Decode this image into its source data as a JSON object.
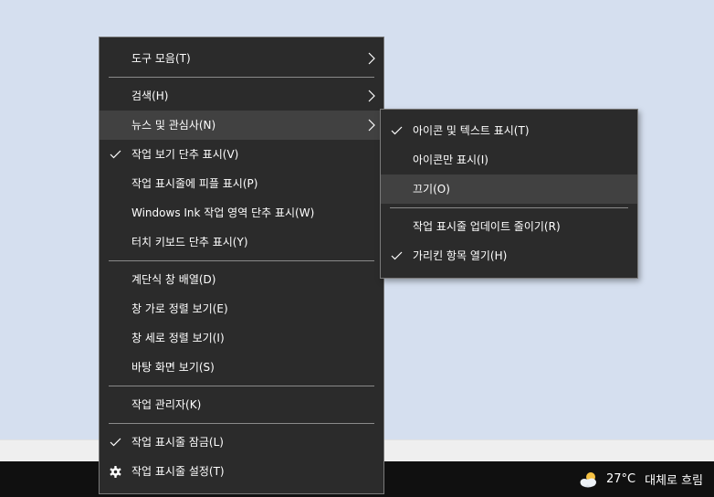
{
  "main_menu": {
    "toolbars": "도구 모음(T)",
    "search": "검색(H)",
    "news": "뉴스 및 관심사(N)",
    "show_task_view": "작업 보기 단추 표시(V)",
    "show_people": "작업 표시줄에 피플 표시(P)",
    "show_ink": "Windows Ink 작업 영역 단추 표시(W)",
    "show_touch_keyboard": "터치 키보드 단추 표시(Y)",
    "cascade": "계단식 창 배열(D)",
    "stacked": "창 가로 정렬 보기(E)",
    "side_by_side": "창 세로 정렬 보기(I)",
    "show_desktop": "바탕 화면 보기(S)",
    "task_manager": "작업 관리자(K)",
    "lock_taskbar": "작업 표시줄 잠금(L)",
    "taskbar_settings": "작업 표시줄 설정(T)"
  },
  "sub_menu": {
    "icon_and_text": "아이콘 및 텍스트 표시(T)",
    "icon_only": "아이콘만 표시(I)",
    "turn_off": "끄기(O)",
    "reduce_updates": "작업 표시줄 업데이트 줄이기(R)",
    "open_on_hover": "가리킨 항목 열기(H)"
  },
  "taskbar": {
    "temperature": "27°C",
    "condition": "대체로 흐림"
  },
  "icons": {
    "check": "check-icon",
    "arrow": "chevron-right-icon",
    "gear": "gear-icon",
    "weather": "partly-cloudy-icon"
  }
}
